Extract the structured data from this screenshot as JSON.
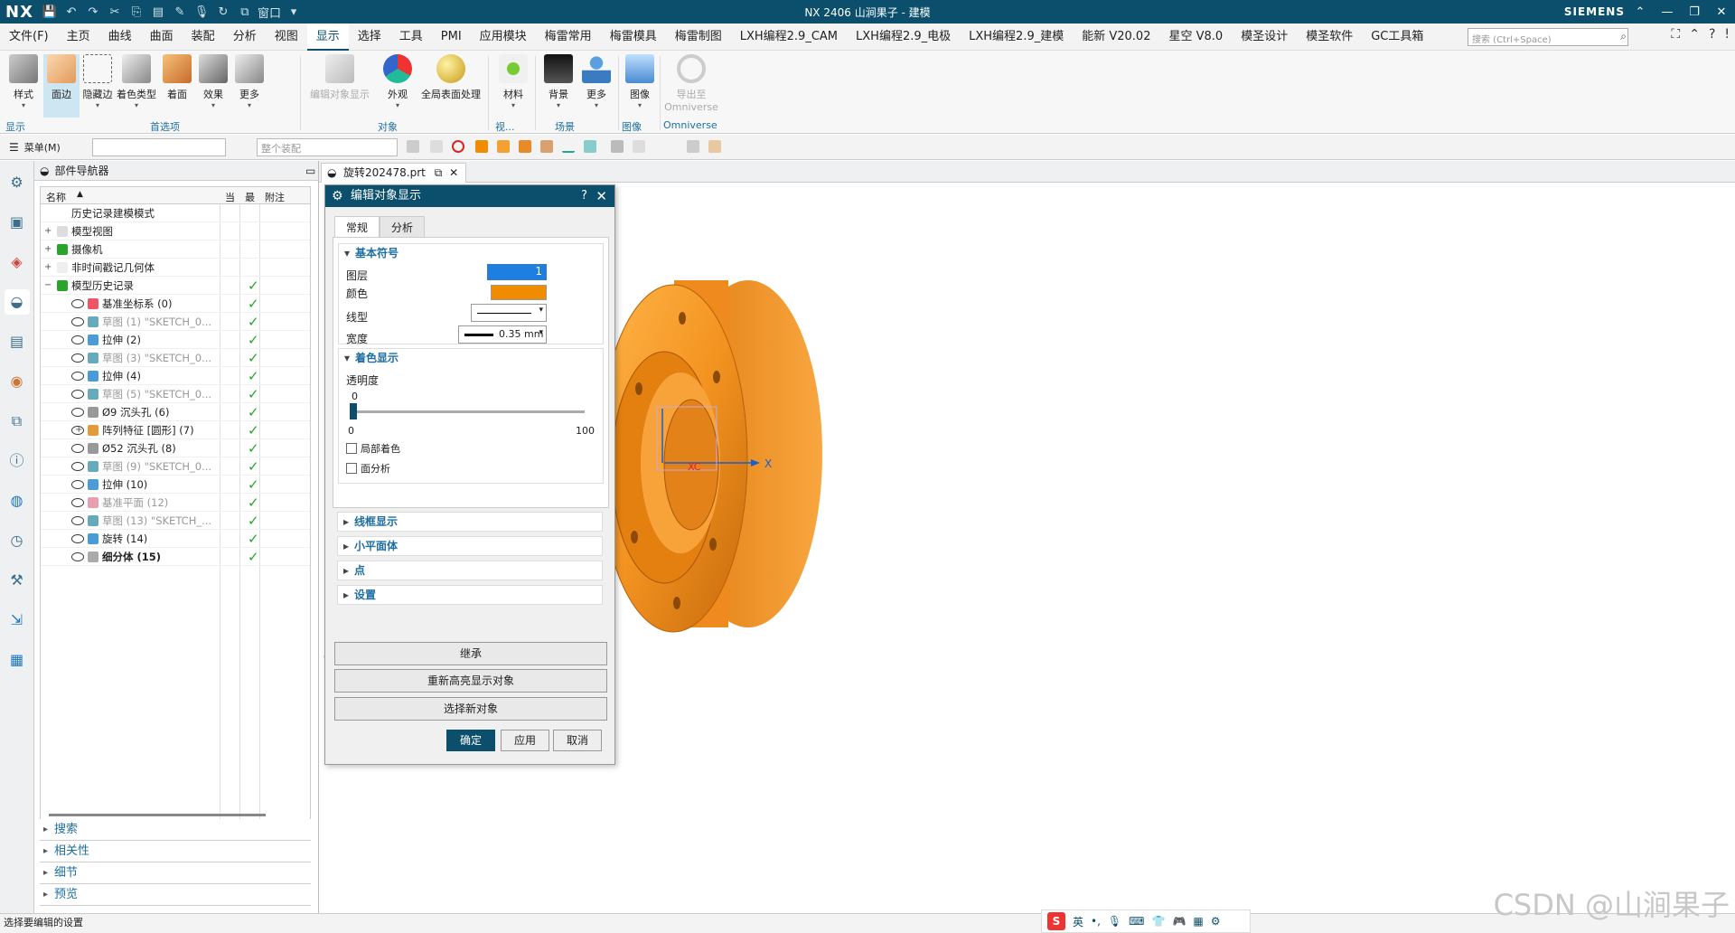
{
  "titlebar": {
    "logo": "NX",
    "title": "NX 2406 山涧果子 - 建模",
    "brand": "SIEMENS",
    "window_menu": "窗口"
  },
  "menubar": {
    "items": [
      "文件(F)",
      "主页",
      "曲线",
      "曲面",
      "装配",
      "分析",
      "视图",
      "显示",
      "选择",
      "工具",
      "PMI",
      "应用模块",
      "梅雷常用",
      "梅雷模具",
      "梅雷制图",
      "LXH编程2.9_CAM",
      "LXH编程2.9_电极",
      "LXH编程2.9_建模",
      "能新 V20.02",
      "星空 V8.0",
      "模圣设计",
      "模圣软件",
      "GC工具箱"
    ],
    "active": "显示",
    "search_placeholder": "搜索 (Ctrl+Space)"
  },
  "ribbon": {
    "display": [
      "样式",
      "面边",
      "隐藏边",
      "着色类型",
      "着面",
      "效果",
      "更多"
    ],
    "objects": [
      "编辑对象显示",
      "外观",
      "全局表面处理"
    ],
    "more": [
      "材料",
      "背景",
      "更多",
      "图像",
      "导出至 Omniverse"
    ],
    "groups": {
      "display": "显示",
      "prefs": "首选项",
      "objects": "对象",
      "views": "视...",
      "scene": "场景",
      "image": "图像",
      "omniverse": "Omniverse"
    }
  },
  "toolbar2": {
    "menu": "菜单(M)",
    "filter_placeholder": "",
    "assembly": "整个装配"
  },
  "navigator": {
    "title": "部件导航器",
    "columns": [
      "名称",
      "当",
      "最",
      "附注"
    ],
    "rows": [
      {
        "label": "历史记录建模模式",
        "state": "plain"
      },
      {
        "label": "模型视图",
        "state": "plain"
      },
      {
        "label": "摄像机",
        "state": "plain"
      },
      {
        "label": "非时间戳记几何体",
        "state": "plain"
      },
      {
        "label": "模型历史记录",
        "state": "plain"
      },
      {
        "label": "基准坐标系 (0)",
        "state": "plain"
      },
      {
        "label": "草图 (1) \"SKETCH_0...",
        "state": "dim"
      },
      {
        "label": "拉伸 (2)",
        "state": "plain"
      },
      {
        "label": "草图 (3) \"SKETCH_0...",
        "state": "dim"
      },
      {
        "label": "拉伸 (4)",
        "state": "plain"
      },
      {
        "label": "草图 (5) \"SKETCH_0...",
        "state": "dim"
      },
      {
        "label": "Ø9 沉头孔 (6)",
        "state": "plain"
      },
      {
        "label": "阵列特征 [圆形] (7)",
        "state": "plain"
      },
      {
        "label": "Ø52 沉头孔 (8)",
        "state": "plain"
      },
      {
        "label": "草图 (9) \"SKETCH_0...",
        "state": "dim"
      },
      {
        "label": "拉伸 (10)",
        "state": "plain"
      },
      {
        "label": "基准平面 (12)",
        "state": "dim"
      },
      {
        "label": "草图 (13) \"SKETCH_...",
        "state": "dim"
      },
      {
        "label": "旋转 (14)",
        "state": "plain"
      },
      {
        "label": "细分体 (15)",
        "state": "bold"
      }
    ],
    "bottom": [
      "搜索",
      "相关性",
      "细节",
      "预览"
    ]
  },
  "doc_tab": "旋转202478.prt",
  "dialog": {
    "title": "编辑对象显示",
    "help": "?",
    "tabs": [
      "常规",
      "分析"
    ],
    "basic": {
      "header": "基本符号",
      "layer_label": "图层",
      "layer_value": "1",
      "color_label": "颜色",
      "color_value": "#f08c00",
      "linetype_label": "线型",
      "width_label": "宽度",
      "width_value": "0.35 mm"
    },
    "shading": {
      "header": "着色显示",
      "transparency_label": "透明度",
      "transparency_value": "0",
      "min": "0",
      "max": "100",
      "partial": "局部着色",
      "face_analysis": "面分析"
    },
    "collapsed": [
      "线框显示",
      "小平面体",
      "点",
      "设置"
    ],
    "buttons": {
      "inherit": "继承",
      "rehighlight": "重新高亮显示对象",
      "select_new": "选择新对象",
      "ok": "确定",
      "apply": "应用",
      "cancel": "取消"
    }
  },
  "viewport": {
    "axis_x": "X",
    "axis_xc": "XC",
    "triad_x": "X",
    "part_color": "#f39320"
  },
  "statusbar": {
    "text": "选择要编辑的设置"
  },
  "ime": {
    "lang": "英"
  },
  "watermark": "CSDN @山涧果子"
}
